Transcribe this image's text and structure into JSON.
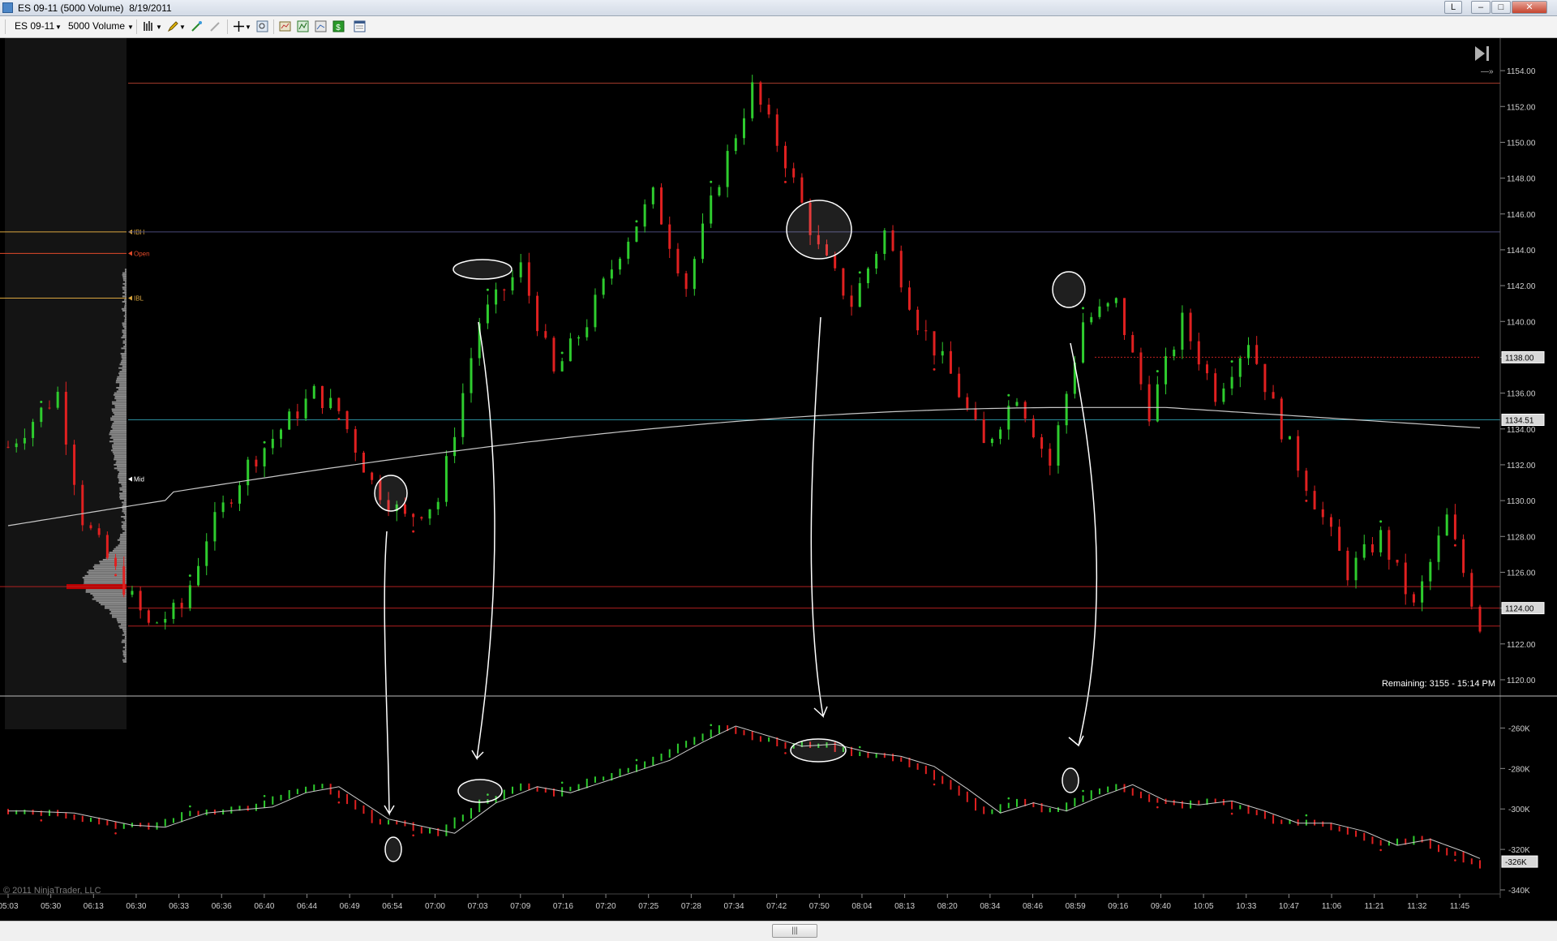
{
  "window": {
    "title": "ES 09-11 (5000 Volume)  8/19/2011",
    "button_link": "L",
    "button_min": "–",
    "button_max": "□",
    "button_close": "✕"
  },
  "toolbar": {
    "instrument": "ES 09-11",
    "period": "5000 Volume",
    "icons": [
      "bar-style-icon",
      "pencil-icon",
      "add-drawing-icon",
      "crosshair-icon",
      "zoom-icon",
      "strategies-icon",
      "indicators-icon",
      "chart-properties-icon",
      "dollar-icon",
      "properties-icon"
    ]
  },
  "chart_data": {
    "type": "candlestick",
    "price_axis": {
      "ticks": [
        "1154.00",
        "1152.00",
        "1150.00",
        "1148.00",
        "1146.00",
        "1144.00",
        "1142.00",
        "1140.00",
        "1138.00",
        "1136.00",
        "1134.00",
        "1132.00",
        "1130.00",
        "1128.00",
        "1126.00",
        "1124.00",
        "1122.00",
        "1120.00"
      ],
      "range": [
        1119.5,
        1155
      ],
      "price_tags": [
        {
          "label": "1138.00",
          "value": 1138.0
        },
        {
          "label": "1134.51",
          "value": 1134.51
        },
        {
          "label": "1124.00",
          "value": 1124.0
        }
      ]
    },
    "indicator_axis": {
      "ticks": [
        "-260K",
        "-280K",
        "-300K",
        "-320K",
        "-340K"
      ],
      "range": [
        -340,
        -251
      ],
      "value_tag": "-326K"
    },
    "time_labels": [
      "05:03",
      "05:30",
      "06:13",
      "06:30",
      "06:33",
      "06:36",
      "06:40",
      "06:44",
      "06:49",
      "06:54",
      "07:00",
      "07:03",
      "07:09",
      "07:16",
      "07:20",
      "07:25",
      "07:28",
      "07:34",
      "07:42",
      "07:50",
      "08:04",
      "08:13",
      "08:20",
      "08:34",
      "08:46",
      "08:59",
      "09:16",
      "09:40",
      "10:05",
      "10:33",
      "10:47",
      "11:06",
      "11:21",
      "11:32",
      "11:45"
    ],
    "levels": [
      {
        "label": "IBH",
        "value": 1145.0
      },
      {
        "label": "Open",
        "value": 1143.8
      },
      {
        "label": "IBL",
        "value": 1141.3
      },
      {
        "label": "Mid",
        "value": 1131.2
      }
    ],
    "high_line": 1153.3,
    "close_price": 1124.5,
    "price_keypoints": [
      [
        0,
        1133
      ],
      [
        6,
        1136
      ],
      [
        9,
        1129
      ],
      [
        13,
        1126
      ],
      [
        17,
        1123
      ],
      [
        21,
        1124
      ],
      [
        24,
        1128
      ],
      [
        29,
        1132
      ],
      [
        33,
        1134
      ],
      [
        37,
        1136
      ],
      [
        40,
        1135
      ],
      [
        44,
        1131
      ],
      [
        48,
        1129
      ],
      [
        52,
        1130
      ],
      [
        57,
        1140
      ],
      [
        62,
        1143
      ],
      [
        66,
        1137
      ],
      [
        70,
        1140
      ],
      [
        74,
        1144
      ],
      [
        78,
        1147
      ],
      [
        82,
        1142
      ],
      [
        86,
        1148
      ],
      [
        90,
        1153
      ],
      [
        94,
        1149
      ],
      [
        98,
        1144
      ],
      [
        102,
        1141
      ],
      [
        106,
        1145
      ],
      [
        110,
        1140
      ],
      [
        114,
        1137
      ],
      [
        118,
        1133
      ],
      [
        122,
        1136
      ],
      [
        126,
        1132
      ],
      [
        130,
        1140
      ],
      [
        134,
        1141
      ],
      [
        138,
        1135
      ],
      [
        142,
        1140
      ],
      [
        146,
        1136
      ],
      [
        150,
        1139
      ],
      [
        154,
        1134
      ],
      [
        158,
        1130
      ],
      [
        162,
        1126
      ],
      [
        166,
        1128
      ],
      [
        170,
        1124
      ],
      [
        174,
        1129
      ],
      [
        178,
        1123
      ]
    ],
    "indicator_keypoints": [
      [
        0,
        -301
      ],
      [
        6,
        -302
      ],
      [
        13,
        -308
      ],
      [
        17,
        -309
      ],
      [
        22,
        -302
      ],
      [
        30,
        -299
      ],
      [
        34,
        -292
      ],
      [
        38,
        -289
      ],
      [
        44,
        -305
      ],
      [
        52,
        -312
      ],
      [
        57,
        -297
      ],
      [
        62,
        -289
      ],
      [
        66,
        -292
      ],
      [
        72,
        -284
      ],
      [
        78,
        -276
      ],
      [
        82,
        -267
      ],
      [
        86,
        -259
      ],
      [
        90,
        -264
      ],
      [
        94,
        -269
      ],
      [
        98,
        -268
      ],
      [
        102,
        -272
      ],
      [
        106,
        -274
      ],
      [
        110,
        -279
      ],
      [
        114,
        -290
      ],
      [
        118,
        -302
      ],
      [
        122,
        -297
      ],
      [
        126,
        -301
      ],
      [
        130,
        -294
      ],
      [
        134,
        -288
      ],
      [
        138,
        -296
      ],
      [
        142,
        -298
      ],
      [
        146,
        -296
      ],
      [
        150,
        -301
      ],
      [
        154,
        -307
      ],
      [
        158,
        -307
      ],
      [
        162,
        -311
      ],
      [
        166,
        -318
      ],
      [
        170,
        -315
      ],
      [
        174,
        -321
      ],
      [
        178,
        -328
      ]
    ],
    "remaining_label": "Remaining: 3155 - 15:14 PM",
    "copyright": "© 2011 NinjaTrader, LLC",
    "colors": {
      "up": "#2ecc2e",
      "down": "#e02020",
      "volume_profile": "#8a8a8a",
      "poc": "#c00000",
      "ma": "#c8c8c8",
      "level": "#d9a640",
      "background": "#000000"
    },
    "annotations": "white hand-drawn circles and arrows linking price swing points to indicator swing points"
  }
}
